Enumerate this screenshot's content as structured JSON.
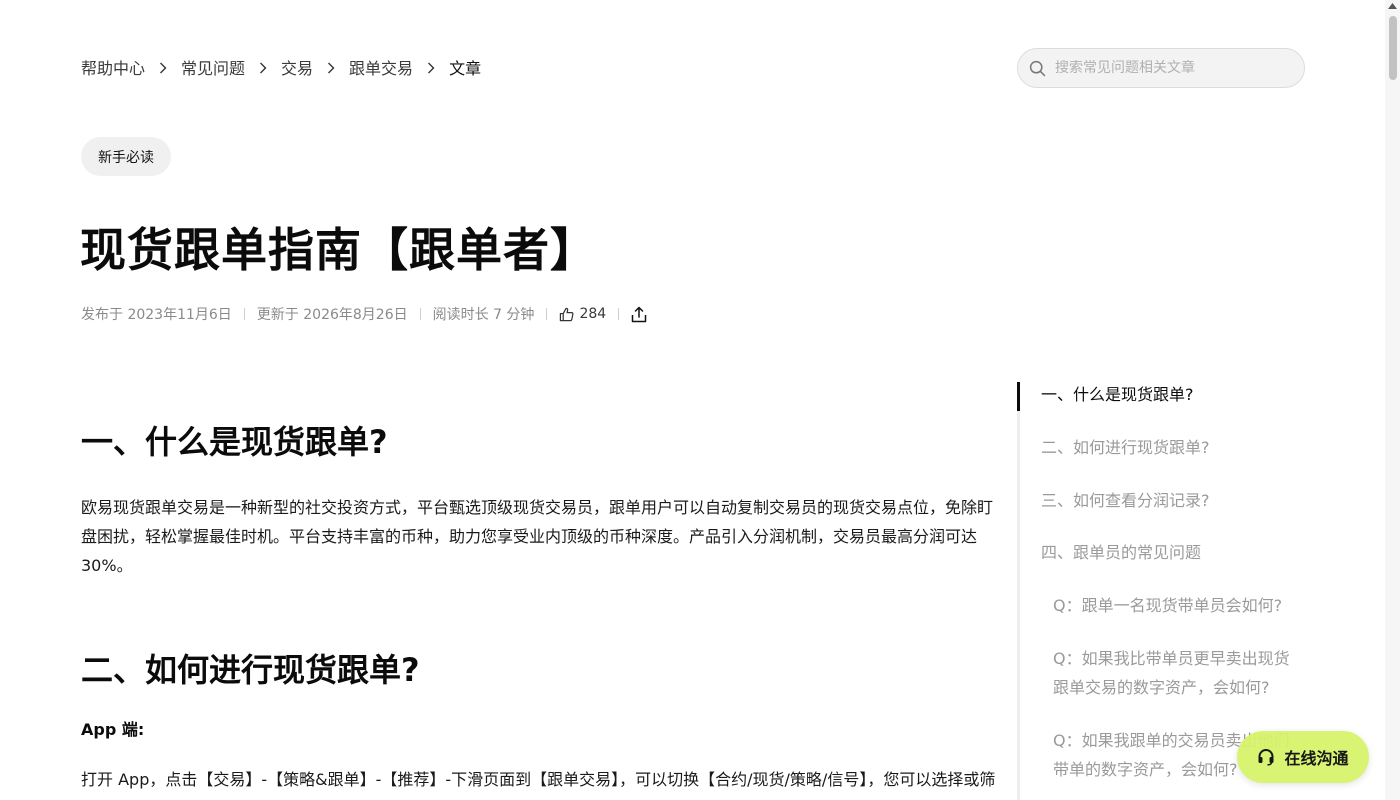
{
  "breadcrumb": {
    "items": [
      "帮助中心",
      "常见问题",
      "交易",
      "跟单交易"
    ],
    "current": "文章"
  },
  "search": {
    "placeholder": "搜索常见问题相关文章"
  },
  "tag": "新手必读",
  "article": {
    "title": "现货跟单指南【跟单者】",
    "published": "发布于 2023年11月6日",
    "updated": "更新于 2026年8月26日",
    "read_time": "阅读时长 7 分钟",
    "likes": "284",
    "sections": [
      {
        "heading": "一、什么是现货跟单?",
        "body": "欧易现货跟单交易是一种新型的社交投资方式，平台甄选顶级现货交易员，跟单用户可以自动复制交易员的现货交易点位，免除盯盘困扰，轻松掌握最佳时机。平台支持丰富的币种，助力您享受业内顶级的币种深度。产品引入分润机制，交易员最高分润可达30%。"
      },
      {
        "heading": "二、如何进行现货跟单?",
        "subheading": "App 端:",
        "body": "打开 App，点击【交易】-【策略&跟单】-【推荐】-下滑页面到【跟单交易】，可以切换【合约/现货/策略/信号】，您可以选择或筛选心仪现货交易员"
      }
    ]
  },
  "toc": {
    "items": [
      "一、什么是现货跟单?",
      "二、如何进行现货跟单?",
      "三、如何查看分润记录?",
      "四、跟单员的常见问题",
      "Q：跟单一名现货带单员会如何?",
      "Q：如果我比带单员更早卖出现货跟单交易的数字资产，会如何?",
      "Q：如果我跟单的交易员卖出他们带单的数字资产，会如何?"
    ]
  },
  "chat": {
    "label": "在线沟通"
  },
  "colors": {
    "accent": "#d7f36b",
    "text": "#0b0b0b",
    "muted": "#9a9a9a"
  }
}
